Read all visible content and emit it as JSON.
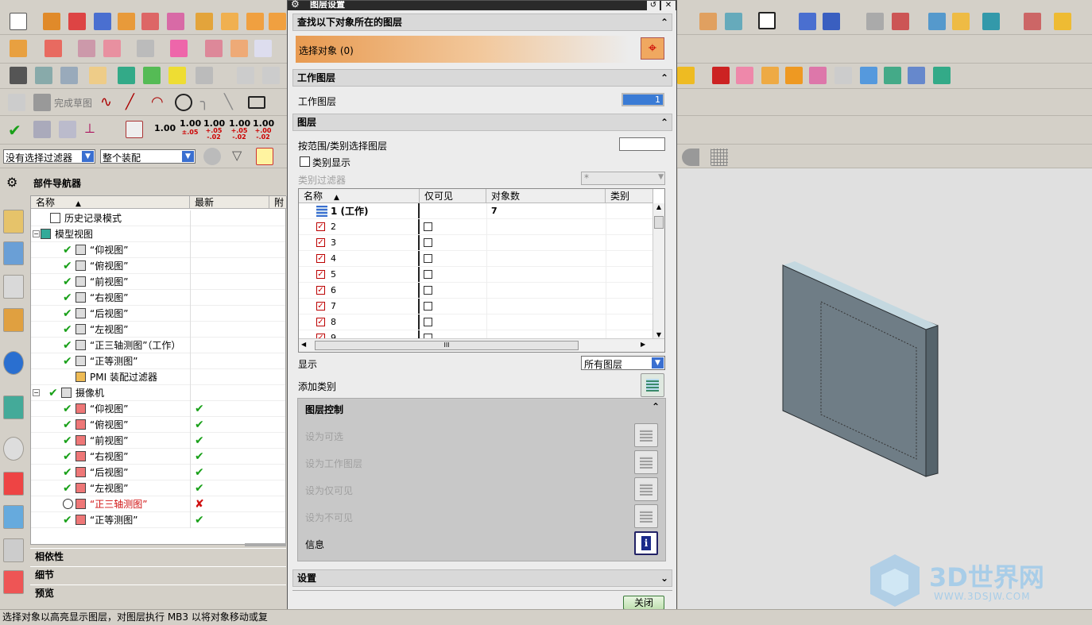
{
  "toolbar": {
    "filter_select": "没有选择过滤器",
    "assembly_select": "整个装配",
    "sketch_finish": "完成草图",
    "numbers": [
      {
        "main": "1.00",
        "sub": ""
      },
      {
        "main": "1.00",
        "sub": "±.05"
      },
      {
        "main": "1.00",
        "sub": "+.05\n-.02"
      },
      {
        "main": "1.00",
        "sub": "+.05\n-.02"
      },
      {
        "main": "1.00",
        "sub": "+.00\n-.02"
      }
    ]
  },
  "navigator": {
    "title": "部件导航器",
    "columns": [
      "名称",
      "最新",
      "附注"
    ],
    "rows": [
      {
        "label": "历史记录模式",
        "latest": "",
        "indent": 1
      },
      {
        "label": "模型视图",
        "latest": "",
        "indent": 0
      },
      {
        "label": "“仰视图”",
        "latest": "",
        "indent": 2
      },
      {
        "label": "“俯视图”",
        "latest": "",
        "indent": 2
      },
      {
        "label": "“前视图”",
        "latest": "",
        "indent": 2
      },
      {
        "label": "“右视图”",
        "latest": "",
        "indent": 2
      },
      {
        "label": "“后视图”",
        "latest": "",
        "indent": 2
      },
      {
        "label": "“左视图”",
        "latest": "",
        "indent": 2
      },
      {
        "label": "“正三轴测图”（工作）",
        "latest": "",
        "indent": 2
      },
      {
        "label": "“正等测图”",
        "latest": "",
        "indent": 2
      },
      {
        "label": "PMI 装配过滤器",
        "latest": "",
        "indent": 2
      },
      {
        "label": "摄像机",
        "latest": "",
        "indent": 0
      },
      {
        "label": "“仰视图”",
        "latest": "✔",
        "indent": 2
      },
      {
        "label": "“俯视图”",
        "latest": "✔",
        "indent": 2
      },
      {
        "label": "“前视图”",
        "latest": "✔",
        "indent": 2
      },
      {
        "label": "“右视图”",
        "latest": "✔",
        "indent": 2
      },
      {
        "label": "“后视图”",
        "latest": "✔",
        "indent": 2
      },
      {
        "label": "“左视图”",
        "latest": "✔",
        "indent": 2
      },
      {
        "label": "“正三轴测图”",
        "latest": "✘",
        "indent": 2
      },
      {
        "label": "“正等测图”",
        "latest": "✔",
        "indent": 2
      }
    ],
    "panels": [
      "相依性",
      "细节",
      "预览"
    ]
  },
  "dialog": {
    "title": "图层设置",
    "find_section": "查找以下对象所在的图层",
    "select_object": "选择对象 (0)",
    "work_layer_section": "工作图层",
    "work_layer_label": "工作图层",
    "work_layer_value": "1",
    "layers_section": "图层",
    "select_by_range": "按范围/类别选择图层",
    "category_display": "类别显示",
    "category_filter": "类别过滤器",
    "category_filter_value": "*",
    "table_columns": [
      "名称",
      "仅可见",
      "对象数",
      "类别"
    ],
    "table_rows": [
      {
        "name": "1 (工作)",
        "count": "7"
      },
      {
        "name": "2",
        "count": ""
      },
      {
        "name": "3",
        "count": ""
      },
      {
        "name": "4",
        "count": ""
      },
      {
        "name": "5",
        "count": ""
      },
      {
        "name": "6",
        "count": ""
      },
      {
        "name": "7",
        "count": ""
      },
      {
        "name": "8",
        "count": ""
      },
      {
        "name": "9",
        "count": ""
      }
    ],
    "scroll_mark": "III",
    "display_label": "显示",
    "display_value": "所有图层",
    "add_category": "添加类别",
    "layer_control_section": "图层控制",
    "control_items": [
      "设为可选",
      "设为工作图层",
      "设为仅可见",
      "设为不可见"
    ],
    "info_label": "信息",
    "settings_section": "设置",
    "close_button": "关闭"
  },
  "watermark": {
    "main": "3D世界网",
    "sub": "WWW.3DSJW.COM"
  },
  "status_text": "选择对象以高亮显示图层，对图层执行 MB3 以将对象移动或复",
  "colors": {
    "accent": "#3a7bd5",
    "ok": "#18a018",
    "error": "#d01010"
  }
}
